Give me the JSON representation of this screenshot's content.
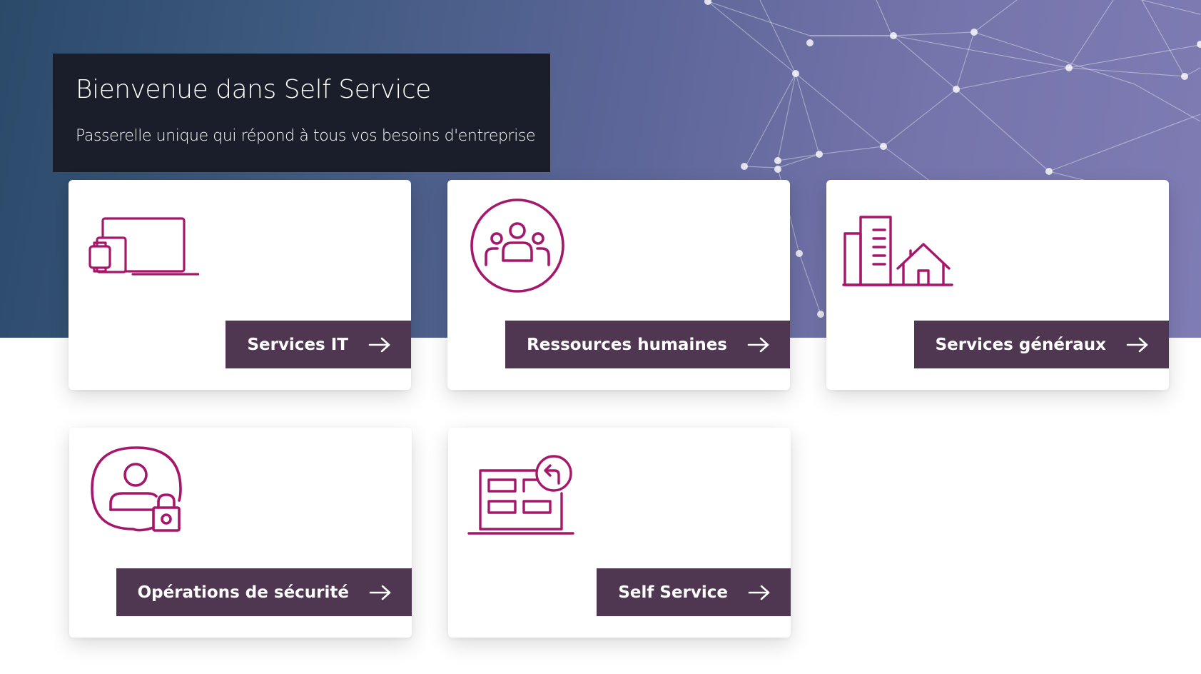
{
  "banner": {
    "title": "Bienvenue dans Self Service",
    "subtitle": "Passerelle unique qui répond à tous vos besoins d'entreprise"
  },
  "colors": {
    "icon": "#a5176b",
    "button_bg": "#4f3752",
    "banner_bg": "#1a1e2a",
    "hero_start": "#2b4a6a",
    "hero_end": "#7f7cb4"
  },
  "cards": [
    {
      "label": "Services IT",
      "icon": "devices-icon"
    },
    {
      "label": "Ressources humaines",
      "icon": "people-group-icon"
    },
    {
      "label": "Services généraux",
      "icon": "buildings-icon"
    },
    {
      "label": "Opérations de sécurité",
      "icon": "user-lock-icon"
    },
    {
      "label": "Self Service",
      "icon": "self-service-portal-icon"
    }
  ]
}
